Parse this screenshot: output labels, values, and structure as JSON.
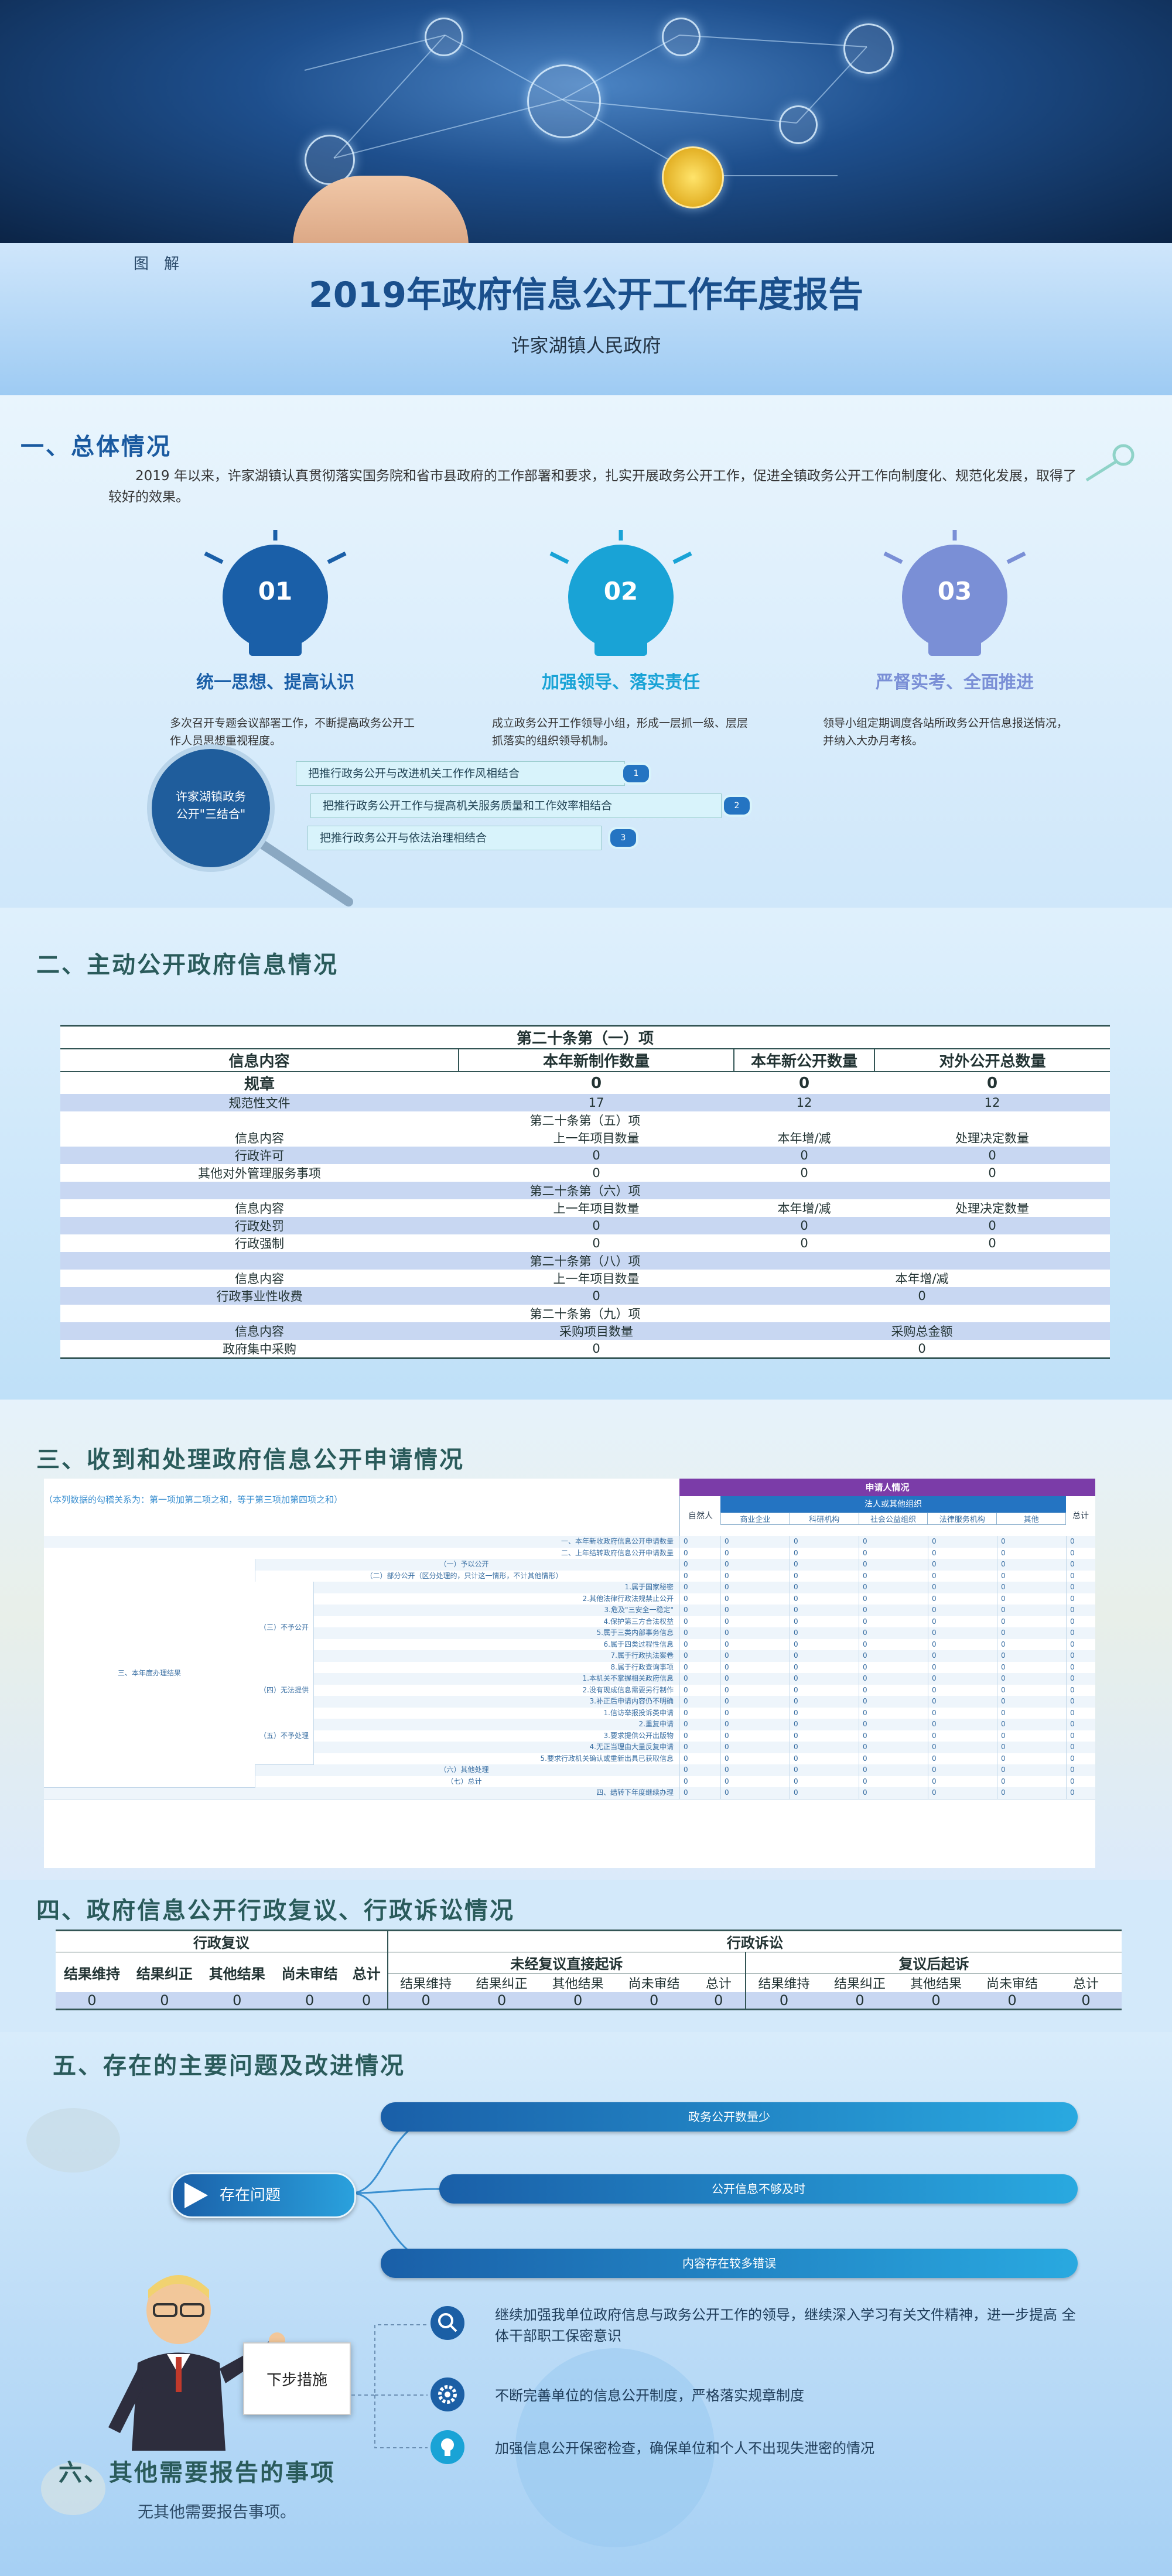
{
  "header": {
    "tag": "图　解",
    "title": "2019年政府信息公开工作年度报告",
    "org": "许家湖镇人民政府"
  },
  "section1": {
    "heading": "一、总体情况",
    "intro": "2019 年以来，许家湖镇认真贯彻落实国务院和省市县政府的工作部署和要求，扎实开展政务公开工作，促进全镇政务公开工作向制度化、规范化发展，取得了较好的效果。",
    "bulbs": [
      {
        "num": "01",
        "title": "统一思想、提高认识",
        "text": "多次召开专题会议部署工作，不断提高政务公开工作人员思想重视程度。",
        "color": "#1a5fa8"
      },
      {
        "num": "02",
        "title": "加强领导、落实责任",
        "text": "成立政务公开工作领导小组，形成一层抓一级、层层抓落实的组织领导机制。",
        "color": "#19a3d6"
      },
      {
        "num": "03",
        "title": "严督实考、全面推进",
        "text": "领导小组定期调度各站所政务公开信息报送情况，并纳入大办月考核。",
        "color": "#7a8fd6"
      }
    ],
    "magnifier_text": "许家湖镇政务\n公开\"三结合\"",
    "points": [
      {
        "text": "把推行政务公开与改进机关工作作风相结合",
        "n": "1"
      },
      {
        "text": "把推行政务公开工作与提高机关服务质量和工作效率相结合",
        "n": "2"
      },
      {
        "text": "把推行政务公开与依法治理相结合",
        "n": "3"
      }
    ]
  },
  "section2": {
    "heading": "二、主动公开政府信息情况",
    "t1_head": "第二十条第（一）项",
    "t1_cols": [
      "信息内容",
      "本年新制作数量",
      "本年新公开数量",
      "对外公开总数量"
    ],
    "t1_rows": [
      [
        "规章",
        "0",
        "0",
        "0"
      ],
      [
        "规范性文件",
        "17",
        "12",
        "12"
      ]
    ],
    "t5_head": "第二十条第（五）项",
    "t5_cols": [
      "信息内容",
      "上一年项目数量",
      "本年增/减",
      "处理决定数量"
    ],
    "t5_rows": [
      [
        "行政许可",
        "0",
        "0",
        "0"
      ],
      [
        "其他对外管理服务事项",
        "0",
        "0",
        "0"
      ]
    ],
    "t6_head": "第二十条第（六）项",
    "t6_cols": [
      "信息内容",
      "上一年项目数量",
      "本年增/减",
      "处理决定数量"
    ],
    "t6_rows": [
      [
        "行政处罚",
        "0",
        "0",
        "0"
      ],
      [
        "行政强制",
        "0",
        "0",
        "0"
      ]
    ],
    "t8_head": "第二十条第（八）项",
    "t8_cols": [
      "信息内容",
      "上一年项目数量",
      "本年增/减"
    ],
    "t8_rows": [
      [
        "行政事业性收费",
        "0",
        "0"
      ]
    ],
    "t9_head": "第二十条第（九）项",
    "t9_cols": [
      "信息内容",
      "采购项目数量",
      "采购总金额"
    ],
    "t9_rows": [
      [
        "政府集中采购",
        "0",
        "0"
      ]
    ]
  },
  "section3": {
    "heading": "三、收到和处理政府信息公开申请情况",
    "note": "（本列数据的勾稽关系为：第一项加第二项之和，等于第三项加第四项之和）",
    "applicant_head": "申请人情况",
    "natural_person": "自然人",
    "legal_head": "法人或其他组织",
    "legal_cols": [
      "商业企业",
      "科研机构",
      "社会公益组织",
      "法律服务机构",
      "其他"
    ],
    "total": "总计",
    "row_new": "一、本年新收政府信息公开申请数量",
    "row_carry": "二、上年结转政府信息公开申请数量",
    "row_third": "三、本年度办理结果",
    "sub_a": "（一）予以公开",
    "sub_b": "（二）部分公开（区分处理的，只计这一情形，不计其他情形）",
    "group_c": "（三）不予公开",
    "group_c_items": [
      "1.属于国家秘密",
      "2.其他法律行政法规禁止公开",
      "3.危及\"三安全一稳定\"",
      "4.保护第三方合法权益",
      "5.属于三类内部事务信息",
      "6.属于四类过程性信息",
      "7.属于行政执法案卷",
      "8.属于行政查询事项"
    ],
    "group_d": "（四）无法提供",
    "group_d_items": [
      "1.本机关不掌握相关政府信息",
      "2.没有现成信息需要另行制作",
      "3.补正后申请内容仍不明确"
    ],
    "group_e": "（五）不予处理",
    "group_e_items": [
      "1.信访举报投诉类申请",
      "2.重复申请",
      "3.要求提供公开出版物",
      "4.无正当理由大量反复申请",
      "5.要求行政机关确认或重新出具已获取信息"
    ],
    "sub_f": "（六）其他处理",
    "sub_g": "（七）总计",
    "row_fourth": "四、结转下年度继续办理",
    "zero": "0"
  },
  "section4": {
    "heading": "四、政府信息公开行政复议、行政诉讼情况",
    "review_head": "行政复议",
    "litig_head": "行政诉讼",
    "review_cols": [
      "结果维持",
      "结果纠正",
      "其他结果",
      "尚未审结",
      "总计"
    ],
    "litig_a": "未经复议直接起诉",
    "litig_b": "复议后起诉",
    "litig_cols": [
      "结果维持",
      "结果纠正",
      "其他结果",
      "尚未审结",
      "总计"
    ],
    "zero": "0"
  },
  "section5": {
    "heading": "五、存在的主要问题及改进情况",
    "problems_label": "存在问题",
    "problems": [
      "政务公开数量少",
      "公开信息不够及时",
      "内容存在较多错误"
    ],
    "next_label": "下步措施",
    "measures": [
      {
        "icon": "search-icon",
        "text": "继续加强我单位政府信息与政务公开工作的领导，继续深入学习有关文件精神，进一步提高 全体干部职工保密意识"
      },
      {
        "icon": "gear-icon",
        "text": "不断完善单位的信息公开制度，严格落实规章制度"
      },
      {
        "icon": "lightbulb-icon",
        "text": "加强信息公开保密检查，确保单位和个人不出现失泄密的情况"
      }
    ]
  },
  "section6": {
    "heading": "六、其他需要报告的事项",
    "text": "无其他需要报告事项。"
  }
}
